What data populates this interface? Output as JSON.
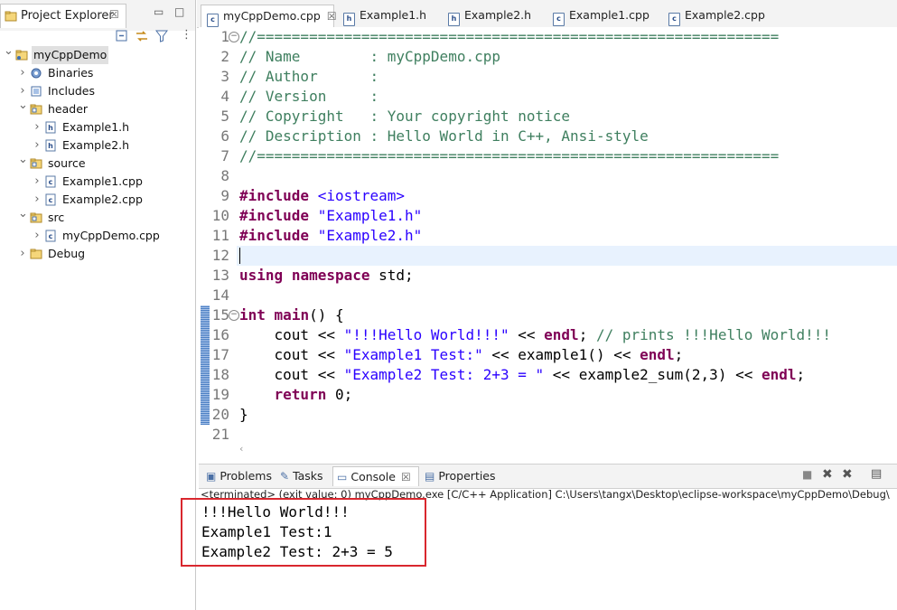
{
  "project_explorer": {
    "title": "Project Explorer",
    "tree": [
      {
        "label": "myCppDemo",
        "depth": 0,
        "arrow": "v",
        "icon": "project-folder-icon",
        "selected": true
      },
      {
        "label": "Binaries",
        "depth": 1,
        "arrow": ">",
        "icon": "binaries-icon"
      },
      {
        "label": "Includes",
        "depth": 1,
        "arrow": ">",
        "icon": "includes-icon"
      },
      {
        "label": "header",
        "depth": 1,
        "arrow": "v",
        "icon": "source-folder-icon"
      },
      {
        "label": "Example1.h",
        "depth": 2,
        "arrow": ">",
        "icon": "header-file-icon"
      },
      {
        "label": "Example2.h",
        "depth": 2,
        "arrow": ">",
        "icon": "header-file-icon"
      },
      {
        "label": "source",
        "depth": 1,
        "arrow": "v",
        "icon": "source-folder-icon"
      },
      {
        "label": "Example1.cpp",
        "depth": 2,
        "arrow": ">",
        "icon": "cpp-file-icon"
      },
      {
        "label": "Example2.cpp",
        "depth": 2,
        "arrow": ">",
        "icon": "cpp-file-icon"
      },
      {
        "label": "src",
        "depth": 1,
        "arrow": "v",
        "icon": "source-folder-icon"
      },
      {
        "label": "myCppDemo.cpp",
        "depth": 2,
        "arrow": ">",
        "icon": "cpp-file-icon"
      },
      {
        "label": "Debug",
        "depth": 1,
        "arrow": ">",
        "icon": "folder-icon"
      }
    ]
  },
  "editor_tabs": [
    {
      "label": "myCppDemo.cpp",
      "badge": "c",
      "active": true
    },
    {
      "label": "Example1.h",
      "badge": "h"
    },
    {
      "label": "Example2.h",
      "badge": "h"
    },
    {
      "label": "Example1.cpp",
      "badge": "c"
    },
    {
      "label": "Example2.cpp",
      "badge": "c"
    }
  ],
  "code_lines": [
    {
      "n": "1",
      "fold": "-",
      "segs": [
        {
          "c": "cm",
          "t": "//============================================================"
        }
      ]
    },
    {
      "n": "2",
      "segs": [
        {
          "c": "cm",
          "t": "// Name        : myCppDemo.cpp"
        }
      ]
    },
    {
      "n": "3",
      "segs": [
        {
          "c": "cm",
          "t": "// Author      :"
        }
      ]
    },
    {
      "n": "4",
      "segs": [
        {
          "c": "cm",
          "t": "// Version     :"
        }
      ]
    },
    {
      "n": "5",
      "segs": [
        {
          "c": "cm",
          "t": "// Copyright   : Your copyright notice"
        }
      ]
    },
    {
      "n": "6",
      "segs": [
        {
          "c": "cm",
          "t": "// Description : Hello World in C++, Ansi-style"
        }
      ]
    },
    {
      "n": "7",
      "segs": [
        {
          "c": "cm",
          "t": "//============================================================"
        }
      ]
    },
    {
      "n": "8",
      "segs": []
    },
    {
      "n": "9",
      "segs": [
        {
          "c": "pp",
          "t": "#include"
        },
        {
          "c": "id",
          "t": " "
        },
        {
          "c": "inc",
          "t": "<iostream>"
        }
      ]
    },
    {
      "n": "10",
      "segs": [
        {
          "c": "pp",
          "t": "#include"
        },
        {
          "c": "id",
          "t": " "
        },
        {
          "c": "str",
          "t": "\"Example1.h\""
        }
      ]
    },
    {
      "n": "11",
      "segs": [
        {
          "c": "pp",
          "t": "#include"
        },
        {
          "c": "id",
          "t": " "
        },
        {
          "c": "str",
          "t": "\"Example2.h\""
        }
      ]
    },
    {
      "n": "12",
      "segs": [],
      "current": true
    },
    {
      "n": "13",
      "segs": [
        {
          "c": "kw",
          "t": "using"
        },
        {
          "c": "id",
          "t": " "
        },
        {
          "c": "kw",
          "t": "namespace"
        },
        {
          "c": "id",
          "t": " std;"
        }
      ]
    },
    {
      "n": "14",
      "segs": []
    },
    {
      "n": "15",
      "fold": "-",
      "marker": true,
      "segs": [
        {
          "c": "kw",
          "t": "int"
        },
        {
          "c": "id",
          "t": " "
        },
        {
          "c": "kw",
          "t": "main"
        },
        {
          "c": "id",
          "t": "() {"
        }
      ]
    },
    {
      "n": "16",
      "marker": true,
      "segs": [
        {
          "c": "id",
          "t": "    cout << "
        },
        {
          "c": "str",
          "t": "\"!!!Hello World!!!\""
        },
        {
          "c": "id",
          "t": " << "
        },
        {
          "c": "kw",
          "t": "endl"
        },
        {
          "c": "id",
          "t": "; "
        },
        {
          "c": "cm",
          "t": "// prints !!!Hello World!!!"
        }
      ]
    },
    {
      "n": "17",
      "marker": true,
      "segs": [
        {
          "c": "id",
          "t": "    cout << "
        },
        {
          "c": "str",
          "t": "\"Example1 Test:\""
        },
        {
          "c": "id",
          "t": " << example1() << "
        },
        {
          "c": "kw",
          "t": "endl"
        },
        {
          "c": "id",
          "t": ";"
        }
      ]
    },
    {
      "n": "18",
      "marker": true,
      "segs": [
        {
          "c": "id",
          "t": "    cout << "
        },
        {
          "c": "str",
          "t": "\"Example2 Test: 2+3 = \""
        },
        {
          "c": "id",
          "t": " << example2_sum(2,3) << "
        },
        {
          "c": "kw",
          "t": "endl"
        },
        {
          "c": "id",
          "t": ";"
        }
      ]
    },
    {
      "n": "19",
      "marker": true,
      "segs": [
        {
          "c": "id",
          "t": "    "
        },
        {
          "c": "kw",
          "t": "return"
        },
        {
          "c": "id",
          "t": " 0;"
        }
      ]
    },
    {
      "n": "20",
      "marker": true,
      "segs": [
        {
          "c": "id",
          "t": "}"
        }
      ]
    },
    {
      "n": "21",
      "segs": []
    }
  ],
  "console_tabs": [
    {
      "label": "Problems",
      "icon": "problems-icon"
    },
    {
      "label": "Tasks",
      "icon": "tasks-icon"
    },
    {
      "label": "Console",
      "icon": "console-icon",
      "active": true
    },
    {
      "label": "Properties",
      "icon": "properties-icon"
    }
  ],
  "console_status": "<terminated> (exit value: 0) myCppDemo.exe [C/C++ Application] C:\\Users\\tangx\\Desktop\\eclipse-workspace\\myCppDemo\\Debug\\",
  "console_output": [
    "!!!Hello World!!!",
    "Example1 Test:1",
    "Example2 Test: 2+3 = 5"
  ],
  "colors": {
    "highlight_box": "#d9272e",
    "comment": "#3f7f5f",
    "keyword": "#7f0055",
    "string": "#2a00ff",
    "current_line": "#e8f2fe"
  }
}
